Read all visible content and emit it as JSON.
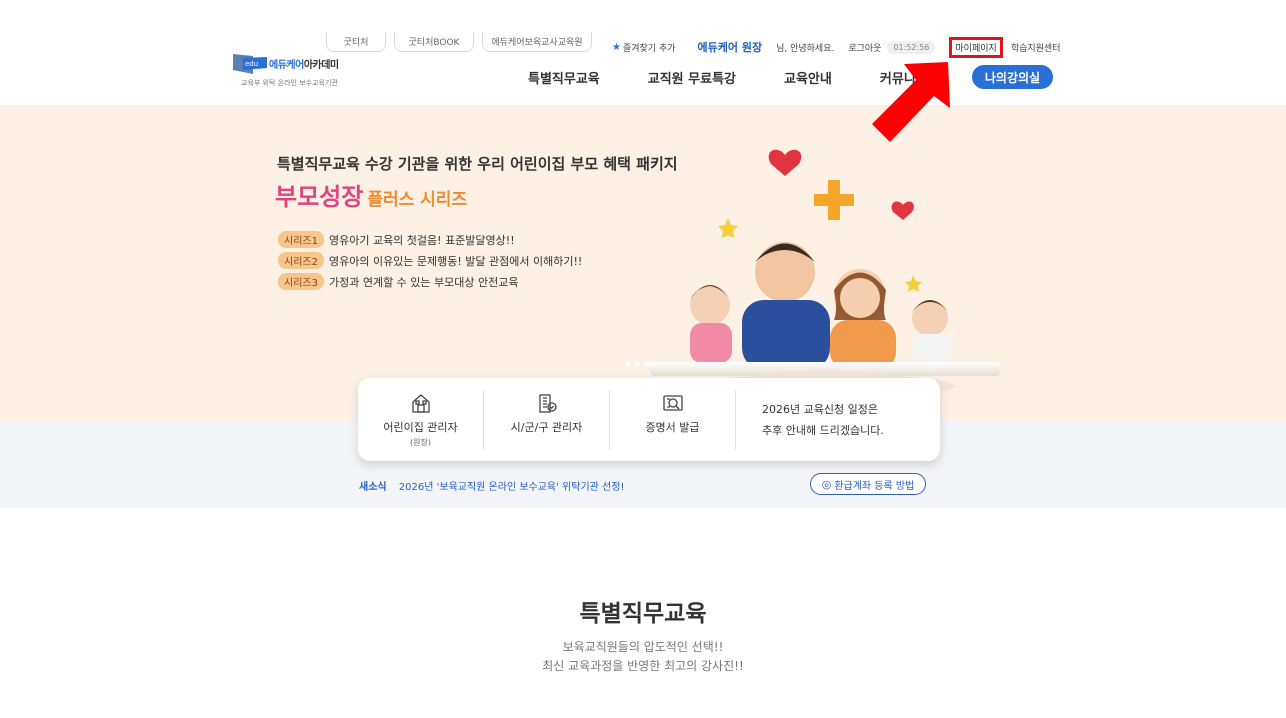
{
  "site_tabs": [
    "굿티처",
    "굿티처BOOK",
    "에듀케어보육교사교육원"
  ],
  "logo": {
    "mark_text": "edu",
    "name_blue": "에듀케어",
    "name_dark": "아카데미",
    "sub": "교육부 위탁 온라인 보수교육기관"
  },
  "util": {
    "favorite": "즐겨찾기 추가",
    "user": "에듀케어 원장",
    "greeting": "님, 안녕하세요.",
    "logout": "로그아웃",
    "timer": "01:52:56",
    "mypage": "마이페이지",
    "help": "학습지원센터"
  },
  "gnb": [
    "특별직무교육",
    "교직원 무료특강",
    "교육안내",
    "커뮤니티"
  ],
  "my_course": "나의강의실",
  "hero": {
    "lead": "특별직무교육 수강 기관을 위한 우리 어린이집 부모 혜택 패키지",
    "title": "부모성장",
    "title_plus": "플러스 시리즈",
    "series": [
      {
        "tag": "시리즈1",
        "text": "영유아기 교육의 첫걸음! 표준발달영상!!"
      },
      {
        "tag": "시리즈2",
        "text": "영유아의 이유있는 문제행동! 발달 관점에서 이해하기!!"
      },
      {
        "tag": "시리즈3",
        "text": "가정과 연계할 수 있는 부모대상 안전교육"
      }
    ]
  },
  "quick": [
    {
      "label": "어린이집 관리자",
      "sub": "(원장)",
      "icon": "building-icon"
    },
    {
      "label": "시/군/구 관리자",
      "sub": "",
      "icon": "office-icon"
    },
    {
      "label": "증명서 발급",
      "sub": "",
      "icon": "certificate-icon"
    }
  ],
  "quick_notice": [
    "2026년 교육신청 일정은",
    "추후 안내해 드리겠습니다."
  ],
  "news": {
    "label": "새소식",
    "text": "2026년 '보육교직원 온라인 보수교육' 위탁기관 선정!"
  },
  "refund_button": "환급계좌 등록 방법",
  "section": {
    "title": "특별직무교육",
    "desc1": "보육교직원들의 압도적인 선택!!",
    "desc2": "최신 교육과정을 반영한 최고의 강사진!!"
  },
  "colors": {
    "brand": "#2a6fd6",
    "highlight": "#e0141b",
    "hero_bg": "#fdf1e5",
    "pink": "#e0447c"
  }
}
